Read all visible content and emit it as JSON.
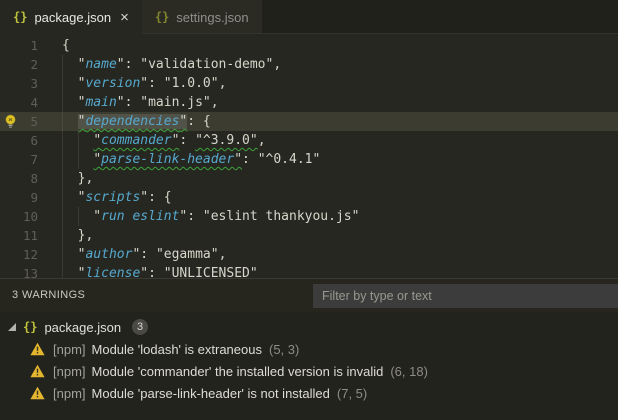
{
  "tabs": [
    {
      "icon": "{}",
      "label": "package.json",
      "close": "×",
      "active": true
    },
    {
      "icon": "{}",
      "label": "settings.json",
      "active": false
    }
  ],
  "colors": {
    "key_blue": "#56a9cf",
    "file_icon_yellow": "#bfc33e",
    "warning_yellow": "#e3b62e",
    "squiggle_green": "#3ba33b",
    "current_line": "#3c3c31"
  },
  "editor": {
    "lines": [
      {
        "num": "1",
        "guides": 0,
        "segs": [
          {
            "t": "{",
            "c": "p"
          }
        ]
      },
      {
        "num": "2",
        "guides": 1,
        "segs": [
          {
            "t": "  \"",
            "c": "p"
          },
          {
            "t": "name",
            "c": "k"
          },
          {
            "t": "\": ",
            "c": "p"
          },
          {
            "t": "\"validation-demo\"",
            "c": "s"
          },
          {
            "t": ",",
            "c": "p"
          }
        ]
      },
      {
        "num": "3",
        "guides": 1,
        "segs": [
          {
            "t": "  \"",
            "c": "p"
          },
          {
            "t": "version",
            "c": "k"
          },
          {
            "t": "\": ",
            "c": "p"
          },
          {
            "t": "\"1.0.0\"",
            "c": "s"
          },
          {
            "t": ",",
            "c": "p"
          }
        ]
      },
      {
        "num": "4",
        "guides": 1,
        "segs": [
          {
            "t": "  \"",
            "c": "p"
          },
          {
            "t": "main",
            "c": "k"
          },
          {
            "t": "\": ",
            "c": "p"
          },
          {
            "t": "\"main.js\"",
            "c": "s"
          },
          {
            "t": ",",
            "c": "p"
          }
        ]
      },
      {
        "num": "5",
        "guides": 1,
        "cur": true,
        "bulb": true,
        "segs": [
          {
            "t": "  ",
            "c": "p"
          },
          {
            "t": "\"",
            "c": "p",
            "sq": 1,
            "hl": 1
          },
          {
            "t": "dependencies",
            "c": "k",
            "sq": 1,
            "hl": 1
          },
          {
            "t": "\"",
            "c": "p",
            "sq": 1,
            "hl": 1
          },
          {
            "t": ": {",
            "c": "p"
          }
        ]
      },
      {
        "num": "6",
        "guides": 2,
        "segs": [
          {
            "t": "    ",
            "c": "p"
          },
          {
            "t": "\"",
            "c": "p",
            "sq": 1
          },
          {
            "t": "commander",
            "c": "k",
            "sq": 1
          },
          {
            "t": "\"",
            "c": "p",
            "sq": 1
          },
          {
            "t": ": ",
            "c": "p"
          },
          {
            "t": "\"^3.9.0\"",
            "c": "s",
            "sq": 1
          },
          {
            "t": ",",
            "c": "p"
          }
        ]
      },
      {
        "num": "7",
        "guides": 2,
        "segs": [
          {
            "t": "    ",
            "c": "p"
          },
          {
            "t": "\"",
            "c": "p",
            "sq": 1
          },
          {
            "t": "parse-link-header",
            "c": "k",
            "sq": 1
          },
          {
            "t": "\"",
            "c": "p",
            "sq": 1
          },
          {
            "t": ": ",
            "c": "p"
          },
          {
            "t": "\"^0.4.1\"",
            "c": "s"
          }
        ]
      },
      {
        "num": "8",
        "guides": 1,
        "segs": [
          {
            "t": "  },",
            "c": "p"
          }
        ]
      },
      {
        "num": "9",
        "guides": 1,
        "segs": [
          {
            "t": "  \"",
            "c": "p"
          },
          {
            "t": "scripts",
            "c": "k"
          },
          {
            "t": "\": {",
            "c": "p"
          }
        ]
      },
      {
        "num": "10",
        "guides": 2,
        "segs": [
          {
            "t": "    \"",
            "c": "p"
          },
          {
            "t": "run eslint",
            "c": "k"
          },
          {
            "t": "\": ",
            "c": "p"
          },
          {
            "t": "\"eslint thankyou.js\"",
            "c": "s"
          }
        ]
      },
      {
        "num": "11",
        "guides": 1,
        "segs": [
          {
            "t": "  },",
            "c": "p"
          }
        ]
      },
      {
        "num": "12",
        "guides": 1,
        "segs": [
          {
            "t": "  \"",
            "c": "p"
          },
          {
            "t": "author",
            "c": "k"
          },
          {
            "t": "\": ",
            "c": "p"
          },
          {
            "t": "\"egamma\"",
            "c": "s"
          },
          {
            "t": ",",
            "c": "p"
          }
        ]
      },
      {
        "num": "13",
        "guides": 1,
        "segs": [
          {
            "t": "  \"",
            "c": "p"
          },
          {
            "t": "license",
            "c": "k"
          },
          {
            "t": "\": ",
            "c": "p"
          },
          {
            "t": "\"UNLICENSED\"",
            "c": "s"
          }
        ]
      }
    ]
  },
  "panel": {
    "title": "3 WARNINGS",
    "filter_placeholder": "Filter by type or text",
    "file_row": {
      "icon": "{}",
      "name": "package.json",
      "badge": "3"
    },
    "warnings": [
      {
        "source": "[npm]",
        "message": "Module 'lodash' is extraneous",
        "location": "(5, 3)"
      },
      {
        "source": "[npm]",
        "message": "Module 'commander' the installed version is invalid",
        "location": "(6, 18)"
      },
      {
        "source": "[npm]",
        "message": "Module 'parse-link-header' is not installed",
        "location": "(7, 5)"
      }
    ]
  }
}
